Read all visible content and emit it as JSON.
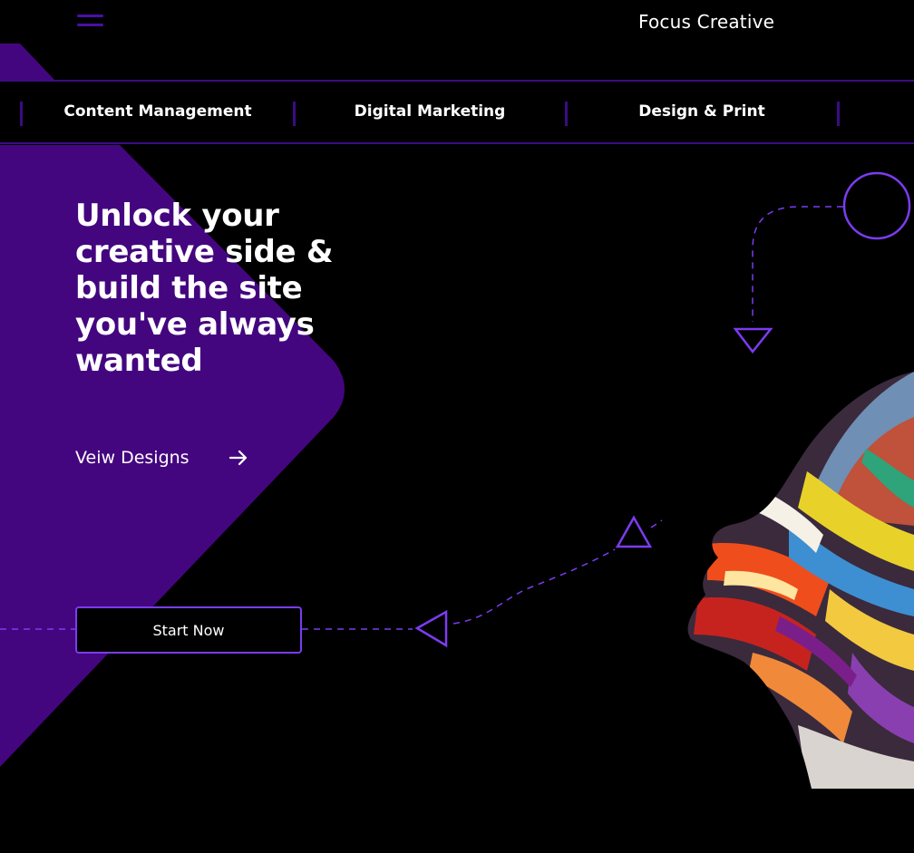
{
  "header": {
    "brand": "Focus Creative",
    "menu_icon": "hamburger-menu-icon"
  },
  "nav": {
    "items": [
      {
        "label": "Content Management"
      },
      {
        "label": "Digital Marketing"
      },
      {
        "label": "Design & Print"
      }
    ]
  },
  "hero": {
    "title": "Unlock your creative side & build the site you've always wanted",
    "view_link": "Veiw Designs",
    "view_icon": "arrow-right-icon",
    "cta": "Start Now",
    "image_alt": "abstract-painted-face-illustration"
  },
  "colors": {
    "background": "#000000",
    "accent_purple": "#44067f",
    "line_purple": "#7b3cf0",
    "text": "#ffffff"
  }
}
